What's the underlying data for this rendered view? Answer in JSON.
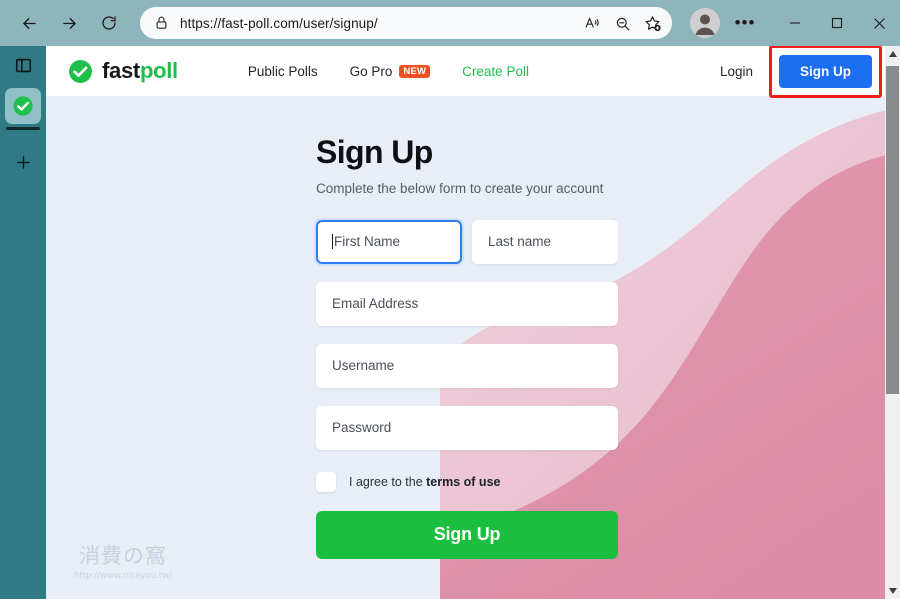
{
  "browser": {
    "url": "https://fast-poll.com/user/signup/",
    "back_label": "Back",
    "forward_label": "Forward",
    "refresh_label": "Refresh",
    "lock_icon": "lock-icon",
    "read_aloud_icon": "read-aloud-icon",
    "zoom_out_icon": "zoom-out-icon",
    "favorites_icon": "add-favorite-star-icon",
    "profile_icon": "profile-avatar-icon",
    "settings_icon": "more-options-ellipsis-icon",
    "minimize_label": "Minimize",
    "maximize_label": "Maximize",
    "close_label": "Close"
  },
  "sidestrip": {
    "tab_actions_icon": "tab-actions-panel-icon",
    "active_tab_icon": "green-check-favicon",
    "new_tab_icon": "plus-new-tab-icon"
  },
  "site_header": {
    "logo_first": "fast",
    "logo_second": "poll",
    "logo_mark_icon": "green-check-circle-logo-icon",
    "nav": [
      {
        "label": "Public Polls",
        "style": "dark",
        "badge": ""
      },
      {
        "label": "Go Pro",
        "style": "dark",
        "badge": "NEW"
      },
      {
        "label": "Create Poll",
        "style": "green",
        "badge": ""
      }
    ],
    "login_label": "Login",
    "signup_label": "Sign Up",
    "signup_button_color": "#1d6ff2",
    "highlight_color": "#f01b1b"
  },
  "main": {
    "title": "Sign Up",
    "subtitle": "Complete the below form to create your account",
    "fields": [
      {
        "name": "first-name",
        "placeholder": "First Name",
        "value": "",
        "focused": true,
        "width": "half"
      },
      {
        "name": "last-name",
        "placeholder": "Last name",
        "value": "",
        "focused": false,
        "width": "half"
      },
      {
        "name": "email-address",
        "placeholder": "Email Address",
        "value": "",
        "focused": false,
        "width": "full"
      },
      {
        "name": "username",
        "placeholder": "Username",
        "value": "",
        "focused": false,
        "width": "full"
      },
      {
        "name": "password",
        "placeholder": "Password",
        "value": "",
        "focused": false,
        "width": "full"
      }
    ],
    "agree_prefix": "I agree to the ",
    "agree_link": "terms of use",
    "agree_checked": false,
    "submit_label": "Sign Up",
    "submit_color": "#1bbf3f",
    "background_color": "#e8edf6",
    "blob_light_color": "#ecc3d3",
    "blob_dark_color": "#dd90a8"
  },
  "watermark": {
    "characters": "消費の窩",
    "url": "http://www.niceyou.tw/"
  },
  "scrollbar": {
    "up_arrow_icon": "scroll-up-arrow-icon",
    "down_arrow_icon": "scroll-down-arrow-icon"
  }
}
